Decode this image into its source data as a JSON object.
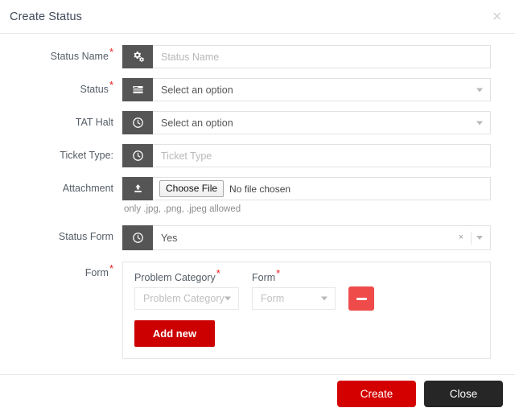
{
  "header": {
    "title": "Create Status",
    "close_label": "✕"
  },
  "fields": {
    "status_name": {
      "label": "Status Name",
      "required": true,
      "icon": "cogs-icon",
      "placeholder": "Status Name",
      "value": ""
    },
    "status": {
      "label": "Status",
      "required": true,
      "icon": "list-icon",
      "placeholder": "Select an option",
      "value": ""
    },
    "tat_halt": {
      "label": "TAT Halt",
      "required": false,
      "icon": "clock-icon",
      "placeholder": "Select an option",
      "value": ""
    },
    "ticket_type": {
      "label": "Ticket Type:",
      "required": false,
      "icon": "clock-icon",
      "placeholder": "Ticket Type",
      "value": ""
    },
    "attachment": {
      "label": "Attachment",
      "required": false,
      "icon": "upload-icon",
      "choose_file_label": "Choose File",
      "no_file_label": "No file chosen",
      "help_text": "only .jpg, .png, .jpeg allowed"
    },
    "status_form": {
      "label": "Status Form",
      "required": false,
      "icon": "clock-icon",
      "value": "Yes",
      "clear_label": "×"
    },
    "form": {
      "label": "Form",
      "required": true
    }
  },
  "form_panel": {
    "problem_category": {
      "label": "Problem Category",
      "required": true,
      "placeholder": "Problem Category",
      "value": ""
    },
    "form_select": {
      "label": "Form",
      "required": true,
      "placeholder": "Form",
      "value": ""
    },
    "remove_label": "−",
    "add_new_label": "Add new"
  },
  "footer": {
    "create_label": "Create",
    "close_label": "Close"
  },
  "colors": {
    "title": "#3f4a5a",
    "required_star": "#f01c1c",
    "addon_bg": "#555555",
    "create_red": "#d40000",
    "add_new_red": "#cc0000",
    "minus_red": "#ef4b4b",
    "close_dark": "#262626"
  }
}
